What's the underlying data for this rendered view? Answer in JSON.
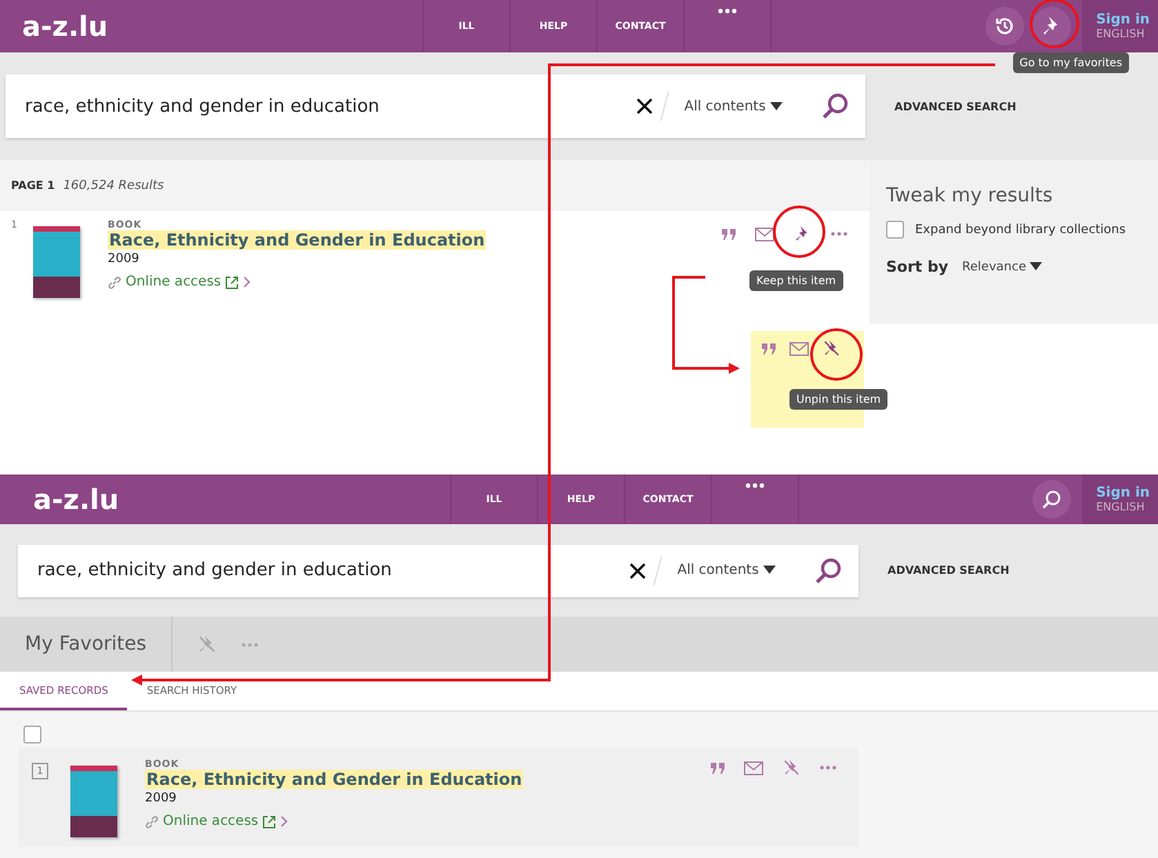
{
  "screens": [
    {
      "kind": "results",
      "header": {
        "logo": "a-z.lu",
        "nav": [
          "ILL",
          "HELP",
          "CONTACT"
        ],
        "tools": [
          {
            "kind": "history"
          },
          {
            "kind": "favorites"
          }
        ],
        "sign_in": "Sign in",
        "language": "ENGLISH"
      },
      "search": {
        "value": "race, ethnicity and gender in education",
        "scope": "All contents",
        "advanced": "ADVANCED SEARCH"
      },
      "tooltip": "Go to my favorites",
      "results_header": {
        "page": "PAGE 1",
        "count": "160,524 Results"
      },
      "result": {
        "number": "1",
        "type": "BOOK",
        "title": "Race, Ethnicity and Gender in Education",
        "year": "2009",
        "link": "Online access",
        "pinned": false
      },
      "keep_tooltip": "Keep this item",
      "pinned_preview": {
        "pinned": true,
        "tooltip": "Unpin this item"
      },
      "tweak": {
        "title": "Tweak my results",
        "checkbox_label": "Expand beyond library collections",
        "checked": false,
        "sort_label": "Sort by",
        "sort_value": "Relevance"
      }
    },
    {
      "kind": "favorites",
      "header": {
        "logo": "a-z.lu",
        "nav": [
          "ILL",
          "HELP",
          "CONTACT"
        ],
        "tools": [
          {
            "kind": "search"
          }
        ],
        "sign_in": "Sign in",
        "language": "ENGLISH"
      },
      "search": {
        "value": "race, ethnicity and gender in education",
        "scope": "All contents",
        "advanced": "ADVANCED SEARCH"
      },
      "favorites_title": "My Favorites",
      "tabs": [
        {
          "label": "SAVED RECORDS",
          "selected": true
        },
        {
          "label": "SEARCH HISTORY",
          "selected": false
        }
      ],
      "select_all_checked": false,
      "result": {
        "number": "1",
        "type": "BOOK",
        "title": "Race, Ethnicity and Gender in Education",
        "year": "2009",
        "link": "Online access",
        "pinned": true
      }
    }
  ]
}
